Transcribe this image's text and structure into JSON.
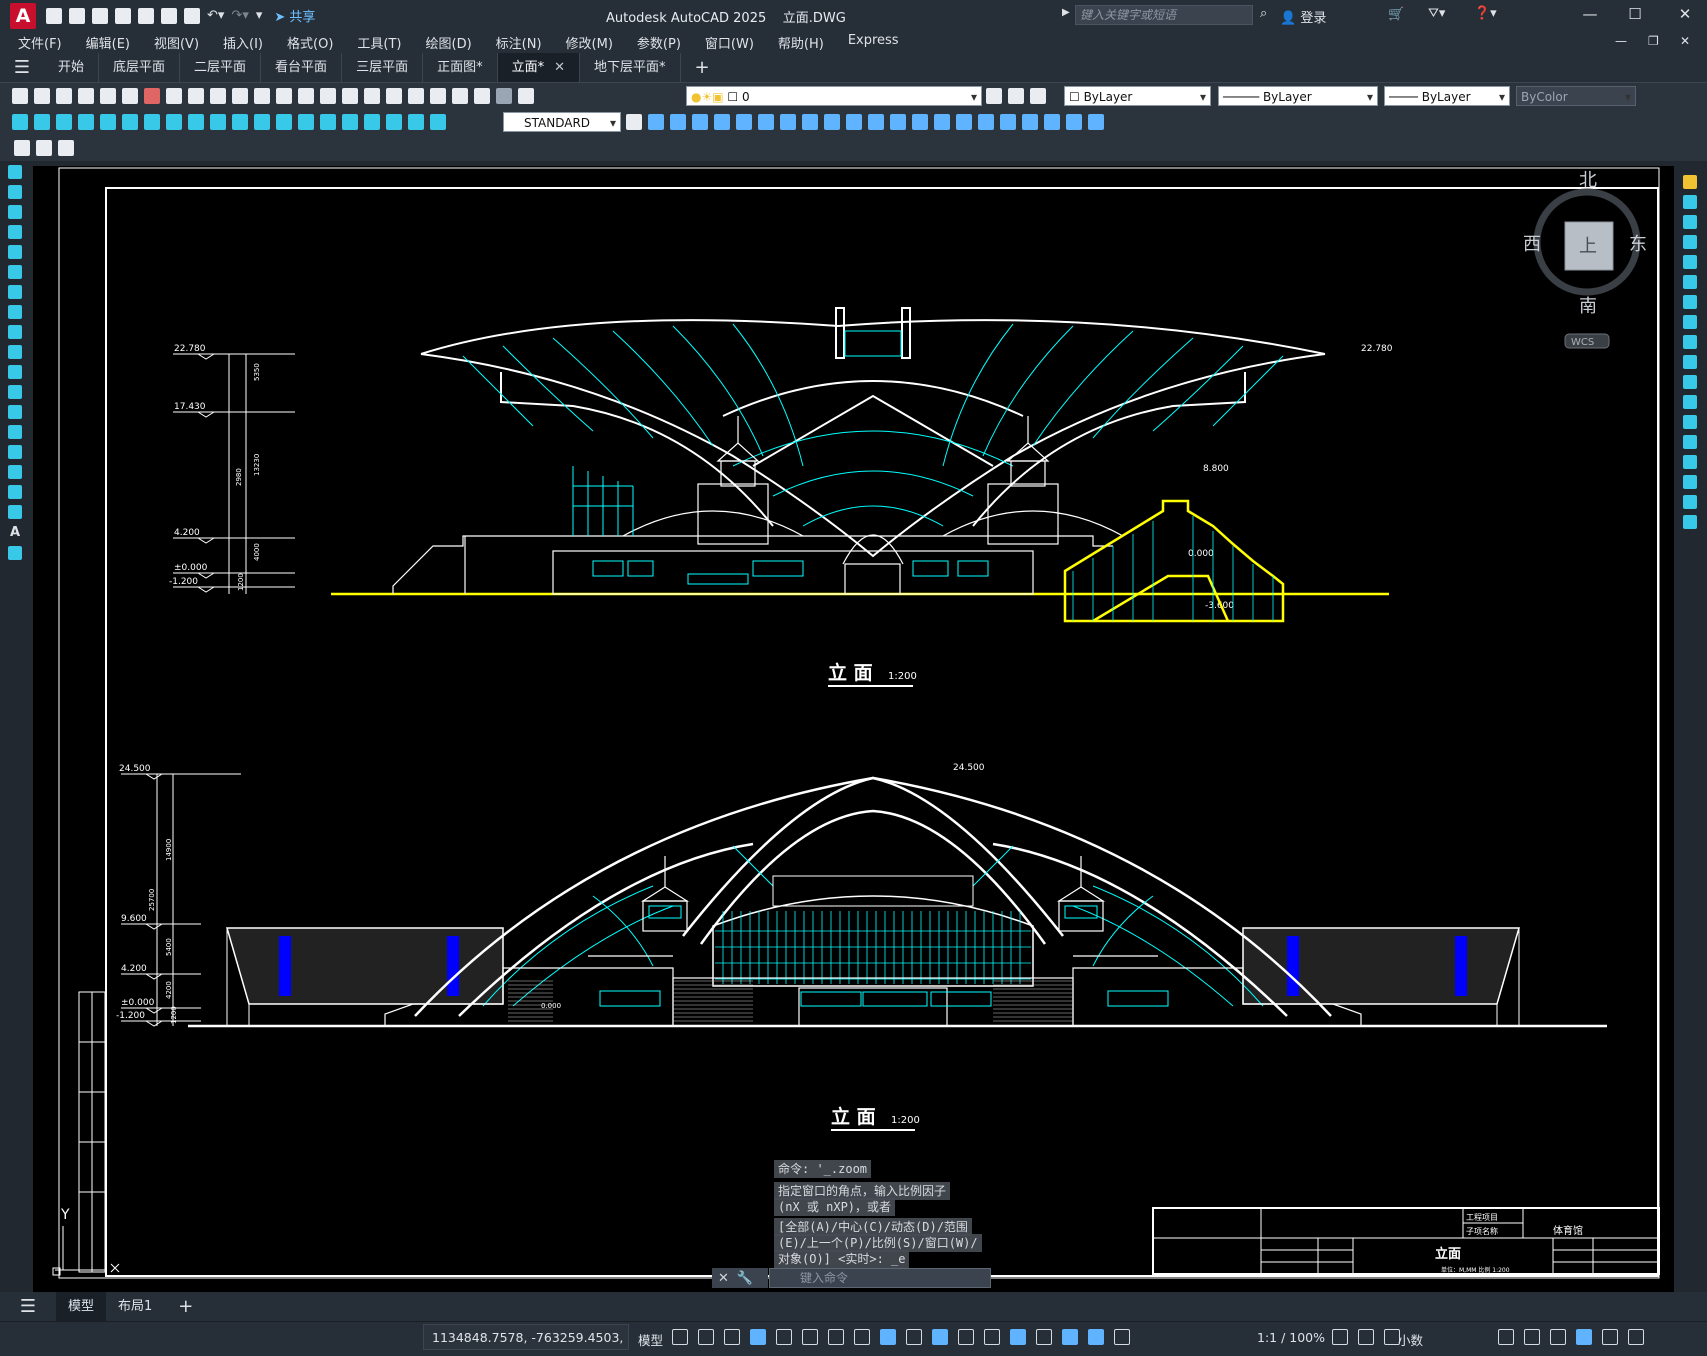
{
  "app": {
    "title": "Autodesk AutoCAD 2025",
    "file": "立面.DWG",
    "share": "共享",
    "search_placeholder": "键入关键字或短语",
    "login": "登录"
  },
  "menu": [
    "文件(F)",
    "编辑(E)",
    "视图(V)",
    "插入(I)",
    "格式(O)",
    "工具(T)",
    "绘图(D)",
    "标注(N)",
    "修改(M)",
    "参数(P)",
    "窗口(W)",
    "帮助(H)",
    "Express"
  ],
  "tabs": [
    {
      "label": "开始"
    },
    {
      "label": "底层平面"
    },
    {
      "label": "二层平面"
    },
    {
      "label": "看台平面"
    },
    {
      "label": "三层平面"
    },
    {
      "label": "正面图*"
    },
    {
      "label": "立面*",
      "active": true
    },
    {
      "label": "地下层平面*"
    }
  ],
  "toolbar": {
    "layer_value": "0",
    "color": "ByLayer",
    "linetype": "ByLayer",
    "lineweight": "ByLayer",
    "plotstyle": "ByColor",
    "textstyle": "STANDARD"
  },
  "viewcube": {
    "north": "北",
    "south": "南",
    "east": "东",
    "west": "西",
    "top": "上",
    "wcs": "WCS"
  },
  "drawing": {
    "title1": "立 面",
    "scale1": "1:200",
    "title2": "立 面",
    "scale2": "1:200",
    "elev1": [
      "22.780",
      "17.430",
      "4.200",
      "±0.000",
      "-1.200"
    ],
    "dims1": [
      "5350",
      "13230",
      "4000",
      "1200",
      "2980"
    ],
    "elev1_right": [
      "22.780",
      "8.800",
      "0.000",
      "-3.600"
    ],
    "elev2": [
      "24.500",
      "9.600",
      "4.200",
      "±0.000",
      "-1.200"
    ],
    "dims2": [
      "14900",
      "25700",
      "5400",
      "4200",
      "1200"
    ],
    "elev2_right": [
      "24.500",
      "0.000"
    ],
    "titleblock": {
      "project": "工程项目",
      "subitem": "子项名称",
      "building": "体育馆",
      "drawing": "立面",
      "scale_note": "单位：M,MM  比例 1:200"
    },
    "ucs_y": "Y"
  },
  "command": {
    "line1": "命令: '_.zoom",
    "line2": "指定窗口的角点，输入比例因子",
    "line3": "(nX 或 nXP)，或者",
    "line4": "[全部(A)/中心(C)/动态(D)/范围",
    "line5": "(E)/上一个(P)/比例(S)/窗口(W)/",
    "line6": "对象(O)] <实时>: _e",
    "placeholder": "键入命令"
  },
  "layouts": [
    {
      "label": "模型",
      "active": true
    },
    {
      "label": "布局1"
    }
  ],
  "status": {
    "coords": "1134848.7578, -763259.4503, 0.00...",
    "model": "模型",
    "scale": "1:1 / 100%",
    "units": "小数"
  },
  "colors": {
    "cyan": "#00ffff",
    "yellow": "#ffff00",
    "blue": "#0000ff",
    "white": "#ffffff"
  }
}
